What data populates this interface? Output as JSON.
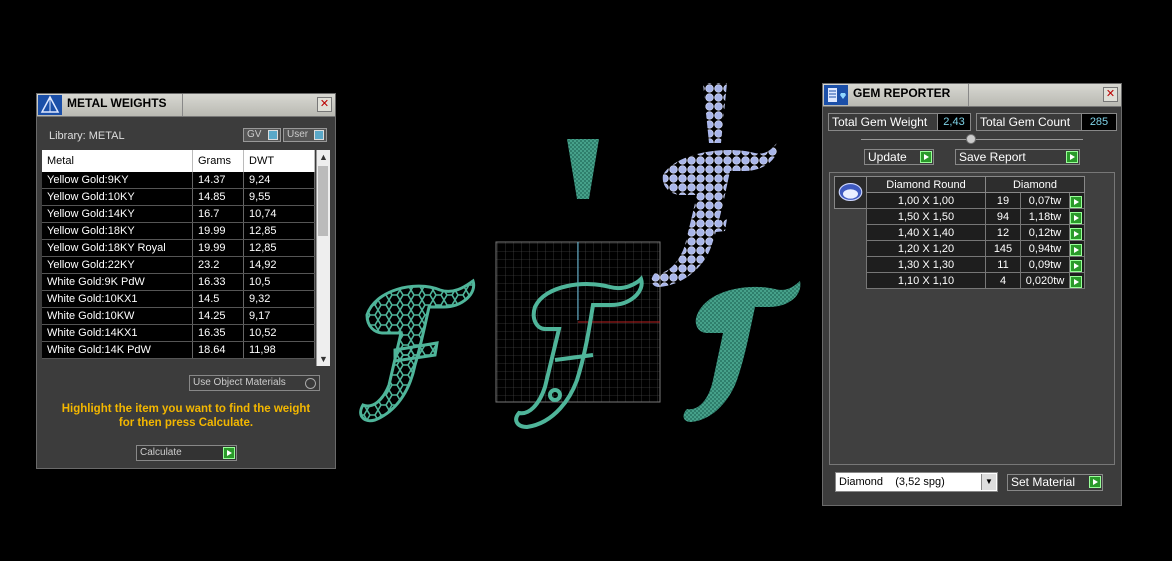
{
  "metal_weights": {
    "title": "METAL WEIGHTS",
    "library_label": "Library: METAL",
    "toggle_gv": "GV",
    "toggle_user": "User",
    "columns": [
      "Metal",
      "Grams",
      "DWT"
    ],
    "rows": [
      [
        "Yellow Gold:9KY",
        "14.37",
        "9,24"
      ],
      [
        "Yellow Gold:10KY",
        "14.85",
        "9,55"
      ],
      [
        "Yellow Gold:14KY",
        "16.7",
        "10,74"
      ],
      [
        "Yellow Gold:18KY",
        "19.99",
        "12,85"
      ],
      [
        "Yellow Gold:18KY Royal",
        "19.99",
        "12,85"
      ],
      [
        "Yellow Gold:22KY",
        "23.2",
        "14,92"
      ],
      [
        "White Gold:9K PdW",
        "16.33",
        "10,5"
      ],
      [
        "White Gold:10KX1",
        "14.5",
        "9,32"
      ],
      [
        "White Gold:10KW",
        "14.25",
        "9,17"
      ],
      [
        "White Gold:14KX1",
        "16.35",
        "10,52"
      ],
      [
        "White Gold:14K PdW",
        "18.64",
        "11,98"
      ]
    ],
    "use_object_materials": "Use Object Materials",
    "hint_line1": "Highlight the item you want to find the weight",
    "hint_line2": "for then press Calculate.",
    "calculate_label": "Calculate"
  },
  "gem_reporter": {
    "title": "GEM REPORTER",
    "total_weight_label": "Total Gem Weight",
    "total_weight_value": "2,43",
    "total_count_label": "Total Gem Count",
    "total_count_value": "285",
    "update_label": "Update",
    "save_report_label": "Save Report",
    "table_headers": [
      "Diamond Round",
      "Diamond"
    ],
    "rows": [
      [
        "1,00 X 1,00",
        "19",
        "0,07tw"
      ],
      [
        "1,50 X 1,50",
        "94",
        "1,18tw"
      ],
      [
        "1,40 X 1,40",
        "12",
        "0,12tw"
      ],
      [
        "1,20 X 1,20",
        "145",
        "0,94tw"
      ],
      [
        "1,30 X 1,30",
        "11",
        "0,09tw"
      ],
      [
        "1,10 X 1,10",
        "4",
        "0,020tw"
      ]
    ],
    "material_selected": "Diamond    (3,52 spg)",
    "set_material_label": "Set Material"
  },
  "colors": {
    "accent_green": "#2a9a2a",
    "model_green": "#4fb59a",
    "gem_blue": "#a9b6ea",
    "hint_yellow": "#f3b700",
    "value_cyan": "#7fd3e8"
  }
}
